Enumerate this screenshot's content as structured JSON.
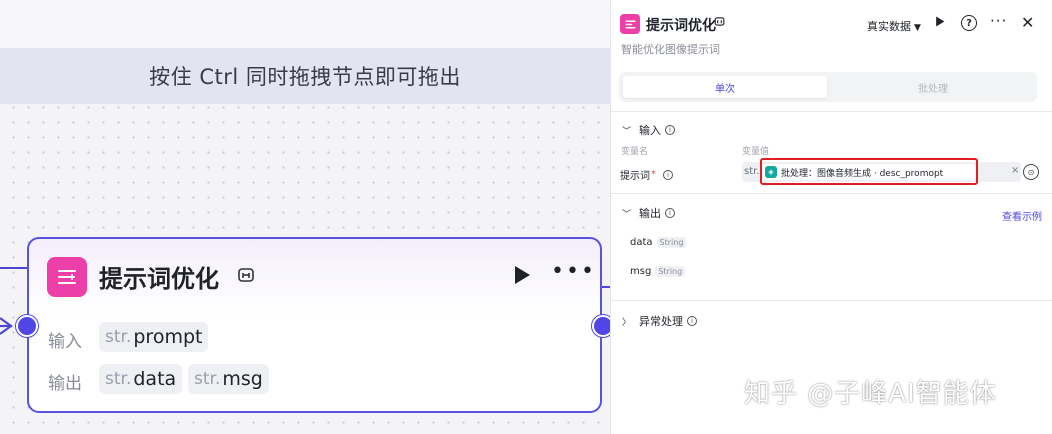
{
  "canvas": {
    "hint": "按住 Ctrl 同时拖拽节点即可拖出"
  },
  "node": {
    "title": "提示词优化",
    "input_label": "输入",
    "output_label": "输出",
    "inputs": [
      {
        "type": "str.",
        "name": "prompt"
      }
    ],
    "outputs": [
      {
        "type": "str.",
        "name": "data"
      },
      {
        "type": "str.",
        "name": "msg"
      }
    ],
    "icons": {
      "node": "list-edit-icon",
      "batch": "batch-icon",
      "run": "play-icon",
      "more": "more-icon"
    }
  },
  "panel": {
    "title": "提示词优化",
    "subtitle": "智能优化图像提示词",
    "data_mode": "真实数据",
    "tabs": {
      "single": "单次",
      "batch": "批处理"
    },
    "input_section": {
      "title": "输入",
      "col_name": "变量名",
      "col_value": "变量值",
      "variable": {
        "label": "提示词",
        "required_mark": "*",
        "type": "str.",
        "reference": "批处理：图像音频生成 · desc_promopt"
      }
    },
    "output_section": {
      "title": "输出",
      "view_example": "查看示例",
      "fields": [
        {
          "name": "data",
          "type": "String"
        },
        {
          "name": "msg",
          "type": "String"
        }
      ]
    },
    "exception_section": {
      "title": "异常处理"
    }
  },
  "watermark": "知乎 @子峰AI智能体",
  "colors": {
    "accent": "#4f46e5",
    "node_icon": "#ec3fa8",
    "highlight": "#e02020",
    "ref_icon": "#13a89e"
  }
}
